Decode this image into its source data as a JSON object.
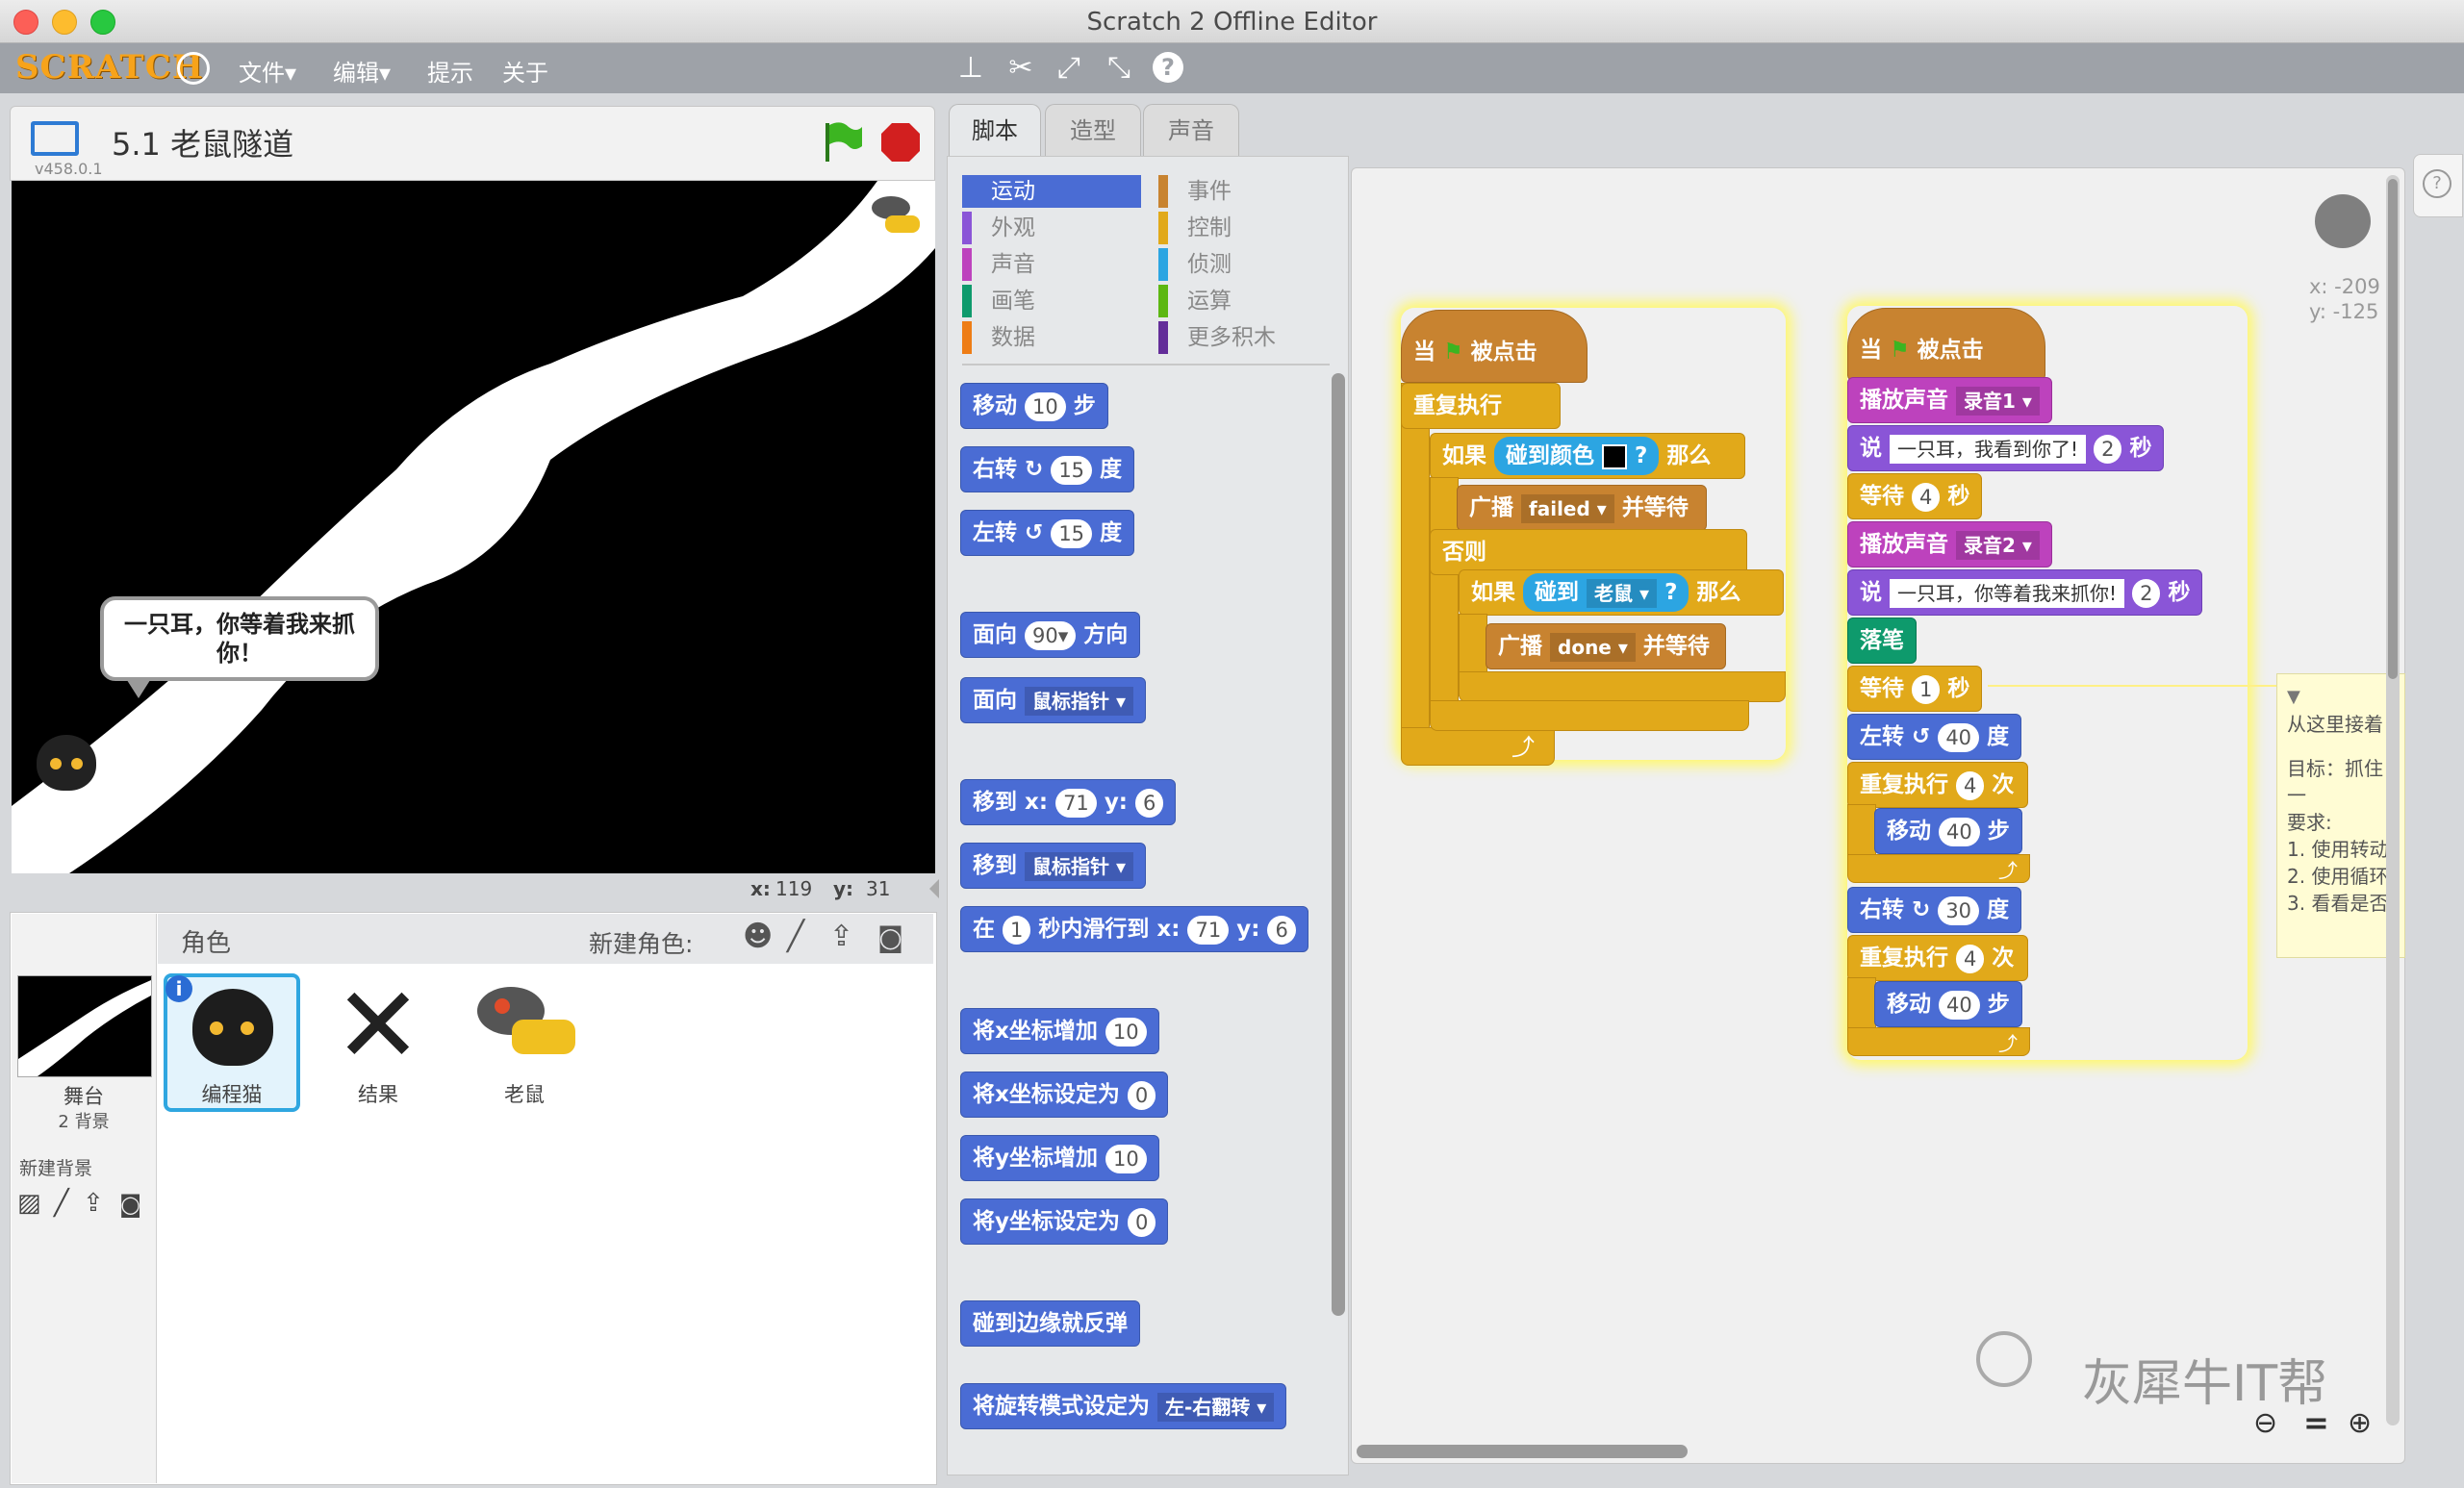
{
  "window": {
    "title": "Scratch 2 Offline Editor"
  },
  "menu": {
    "logo": "SCRATCH",
    "file": "文件▾",
    "edit": "编辑▾",
    "tips": "提示",
    "about": "关于"
  },
  "stage": {
    "project_title": "5.1 老鼠隧道",
    "version": "v458.0.1",
    "speech": "一只耳，你等着我来抓你！",
    "x_label": "x:",
    "x_value": "119",
    "y_label": "y:",
    "y_value": "31"
  },
  "sprites": {
    "header": "角色",
    "new_sprite": "新建角色:",
    "stage_label": "舞台",
    "stage_backdrops": "2 背景",
    "new_backdrop": "新建背景",
    "items": [
      "编程猫",
      "结果",
      "老鼠"
    ]
  },
  "tabs": [
    "脚本",
    "造型",
    "声音"
  ],
  "categories": {
    "left": [
      "运动",
      "外观",
      "声音",
      "画笔",
      "数据"
    ],
    "right": [
      "事件",
      "控制",
      "侦测",
      "运算",
      "更多积木"
    ]
  },
  "palette": {
    "move": "移动",
    "steps": "步",
    "move_n": "10",
    "turn_right": "右转",
    "turn_left": "左转",
    "deg": "度",
    "turn_n": "15",
    "point_dir": "面向",
    "dir_n": "90▾",
    "direction": "方向",
    "point_to": "面向",
    "mouse": "鼠标指针 ▾",
    "goto": "移到 x:",
    "gx": "71",
    "y_lbl": "y:",
    "gy": "6",
    "goto2": "移到",
    "glide_in": "在",
    "glide_n": "1",
    "glide_mid": "秒内滑行到 x:",
    "chx": "将x坐标增加",
    "chx_n": "10",
    "setx": "将x坐标设定为",
    "setx_n": "0",
    "chy": "将y坐标增加",
    "chy_n": "10",
    "sety": "将y坐标设定为",
    "sety_n": "0",
    "bounce": "碰到边缘就反弹",
    "rot": "将旋转模式设定为",
    "rot_v": "左-右翻转 ▾"
  },
  "script1": {
    "when": "当",
    "clicked": "被点击",
    "forever": "重复执行",
    "if": "如果",
    "touch_color": "碰到颜色",
    "q": "?",
    "then": "那么",
    "broadcast": "广播",
    "failed": "failed ▾",
    "and_wait": "并等待",
    "else": "否则",
    "touching": "碰到",
    "mouse": "老鼠 ▾",
    "done": "done ▾"
  },
  "script2": {
    "when": "当",
    "clicked": "被点击",
    "play": "播放声音",
    "rec1": "录音1 ▾",
    "say": "说",
    "say1": "一只耳，我看到你了!",
    "secs": "秒",
    "n2": "2",
    "wait": "等待",
    "w4": "4",
    "rec2": "录音2 ▾",
    "say2": "一只耳，你等着我来抓你!",
    "pen_down": "落笔",
    "w1": "1",
    "turn_left": "左转",
    "deg": "度",
    "n40": "40",
    "repeat": "重复执行",
    "times": "次",
    "n4": "4",
    "move": "移动",
    "steps": "步",
    "turn_right": "右转",
    "n30": "30"
  },
  "sprite_info": {
    "x": "x: -209",
    "y": "y: -125"
  },
  "note": {
    "text": "从这里接着",
    "l1": "目标：抓住一",
    "l2": "要求:",
    "l3": "1. 使用转动",
    "l4": "2. 使用循环",
    "l5": "3. 看看是否"
  },
  "watermark": "灰犀牛IT帮"
}
